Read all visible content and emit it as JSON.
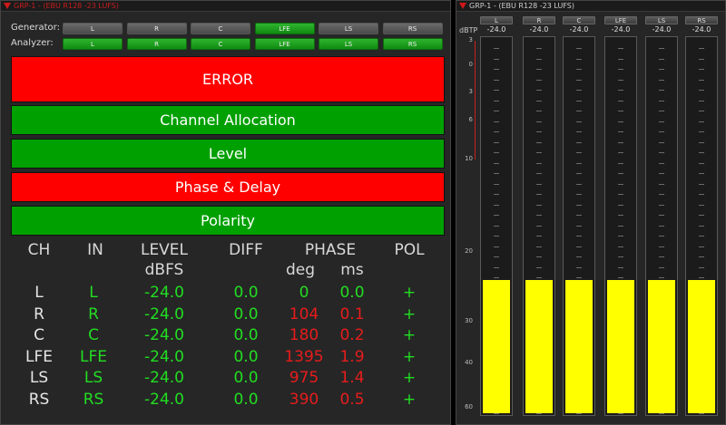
{
  "left_panel": {
    "title": "GRP-1 - (EBU R128 -23 LUFS)",
    "generator_label": "Generator:",
    "analyzer_label": "Analyzer:",
    "generator_buttons": [
      {
        "label": "L",
        "active": false
      },
      {
        "label": "R",
        "active": false
      },
      {
        "label": "C",
        "active": false
      },
      {
        "label": "LFE",
        "active": true
      },
      {
        "label": "LS",
        "active": false
      },
      {
        "label": "RS",
        "active": false
      }
    ],
    "analyzer_buttons": [
      {
        "label": "L",
        "active": true
      },
      {
        "label": "R",
        "active": true
      },
      {
        "label": "C",
        "active": true
      },
      {
        "label": "LFE",
        "active": true
      },
      {
        "label": "LS",
        "active": true
      },
      {
        "label": "RS",
        "active": true
      }
    ],
    "status_bars": [
      {
        "label": "ERROR",
        "status": "red"
      },
      {
        "label": "Channel Allocation",
        "status": "green"
      },
      {
        "label": "Level",
        "status": "green"
      },
      {
        "label": "Phase & Delay",
        "status": "red"
      },
      {
        "label": "Polarity",
        "status": "green"
      }
    ],
    "table": {
      "headers": {
        "ch": "CH",
        "in": "IN",
        "level": "LEVEL",
        "level_unit": "dBFS",
        "diff": "DIFF",
        "phase": "PHASE",
        "phase_deg": "deg",
        "phase_ms": "ms",
        "pol": "POL"
      },
      "rows": [
        {
          "ch": "L",
          "in": "L",
          "level": "-24.0",
          "diff": "0.0",
          "deg": "0",
          "ms": "0.0",
          "pol": "+",
          "phase_ok": true
        },
        {
          "ch": "R",
          "in": "R",
          "level": "-24.0",
          "diff": "0.0",
          "deg": "104",
          "ms": "0.1",
          "pol": "+",
          "phase_ok": false
        },
        {
          "ch": "C",
          "in": "C",
          "level": "-24.0",
          "diff": "0.0",
          "deg": "180",
          "ms": "0.2",
          "pol": "+",
          "phase_ok": false
        },
        {
          "ch": "LFE",
          "in": "LFE",
          "level": "-24.0",
          "diff": "0.0",
          "deg": "1395",
          "ms": "1.9",
          "pol": "+",
          "phase_ok": false
        },
        {
          "ch": "LS",
          "in": "LS",
          "level": "-24.0",
          "diff": "0.0",
          "deg": "975",
          "ms": "1.4",
          "pol": "+",
          "phase_ok": false
        },
        {
          "ch": "RS",
          "in": "RS",
          "level": "-24.0",
          "diff": "0.0",
          "deg": "390",
          "ms": "0.5",
          "pol": "+",
          "phase_ok": false
        }
      ]
    }
  },
  "right_panel": {
    "title": "GRP-1 - (EBU R128 -23 LUFS)",
    "unit": "dBTP",
    "scale": [
      "3",
      "0",
      "3",
      "6",
      "10",
      "20",
      "30",
      "40",
      "60"
    ],
    "meters": [
      {
        "label": "L",
        "value": "-24.0",
        "level": -24.0
      },
      {
        "label": "R",
        "value": "-24.0",
        "level": -24.0
      },
      {
        "label": "C",
        "value": "-24.0",
        "level": -24.0
      },
      {
        "label": "LFE",
        "value": "-24.0",
        "level": -24.0
      },
      {
        "label": "LS",
        "value": "-24.0",
        "level": -24.0
      },
      {
        "label": "RS",
        "value": "-24.0",
        "level": -24.0
      }
    ]
  },
  "colors": {
    "ok": "#00a000",
    "error": "#ff0000",
    "meter_fill": "#ffff00"
  }
}
